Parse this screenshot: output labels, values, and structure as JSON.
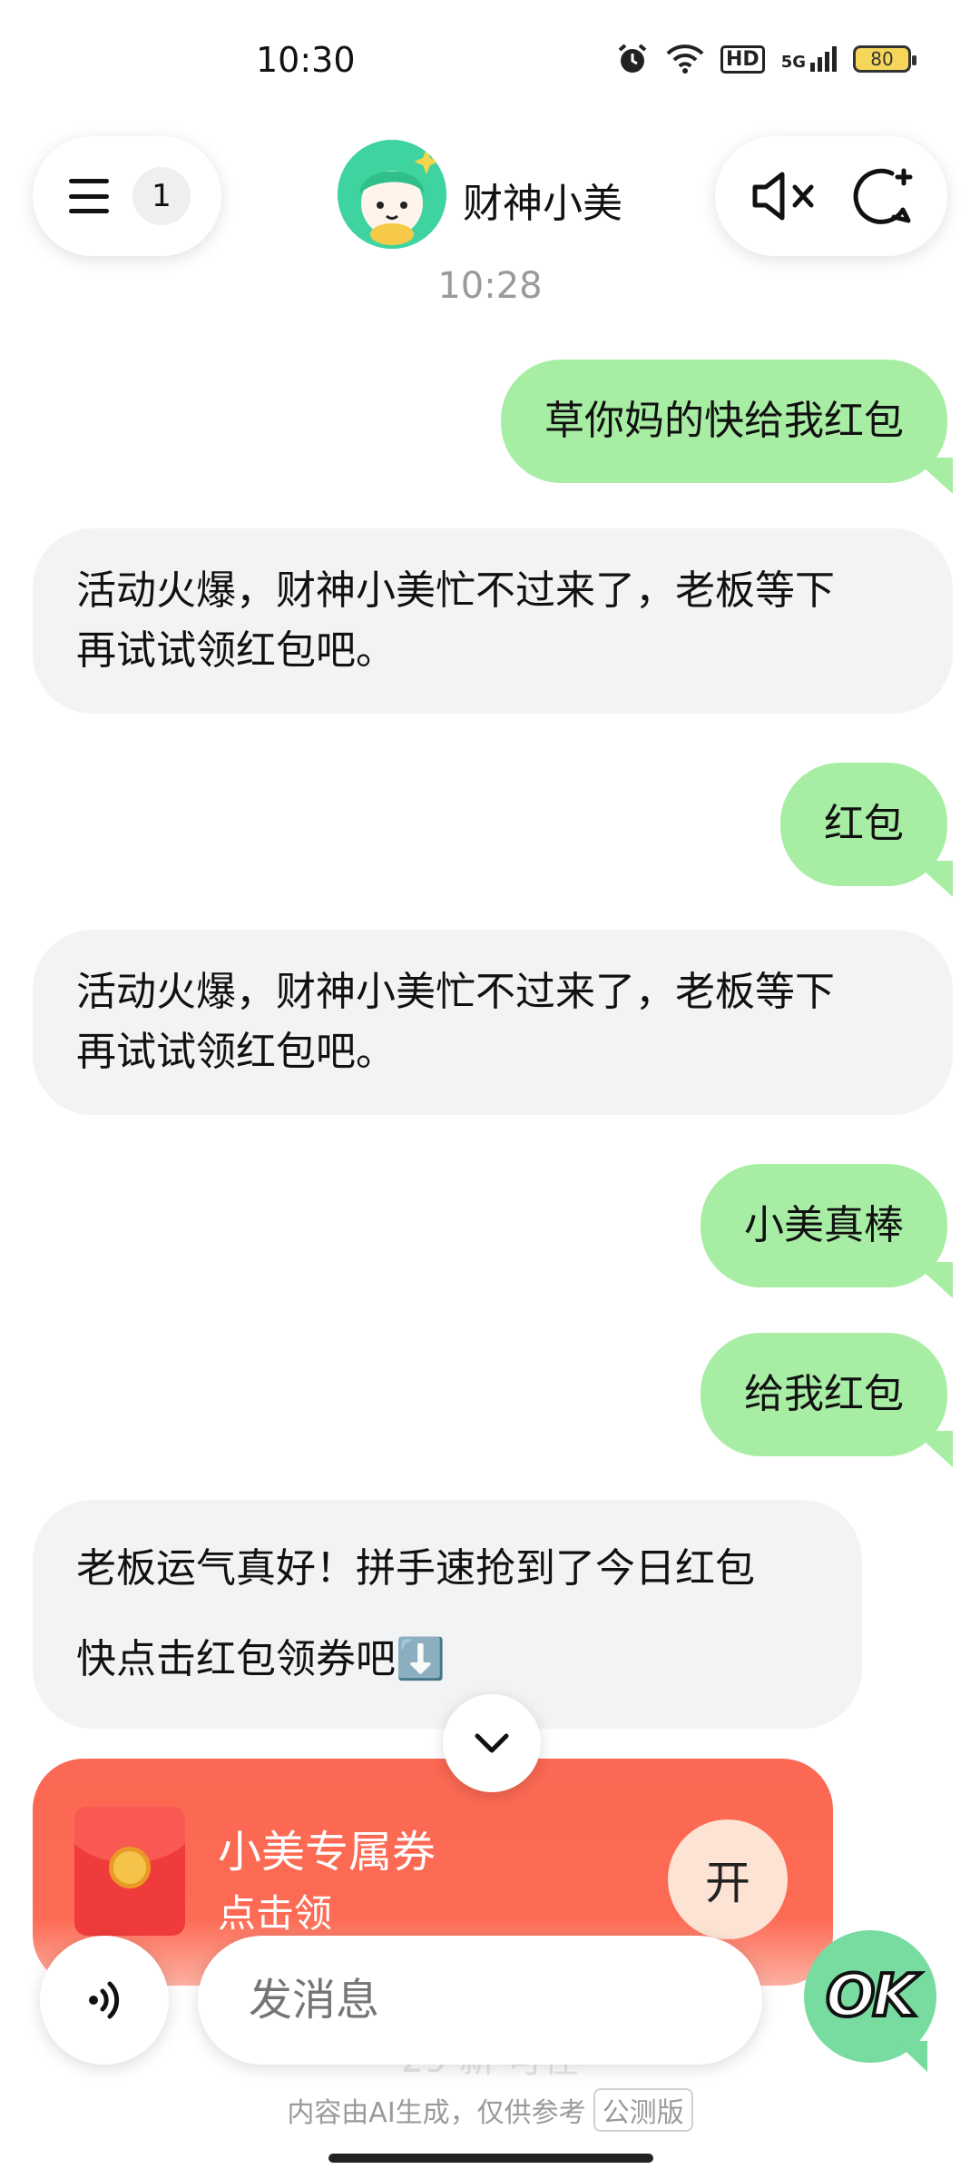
{
  "status_bar": {
    "time": "10:30",
    "hd_label": "HD",
    "network_label": "5G",
    "battery": "80"
  },
  "header": {
    "unread_count": "1",
    "bot_name": "财神小美",
    "timestamp": "10:28"
  },
  "messages": [
    {
      "role": "user",
      "text": "草你妈的快给我红包"
    },
    {
      "role": "bot",
      "lines": [
        "活动火爆，财神小美忙不过来了，老板等下",
        "再试试领红包吧。"
      ]
    },
    {
      "role": "user",
      "text": "红包"
    },
    {
      "role": "bot",
      "lines": [
        "活动火爆，财神小美忙不过来了，老板等下",
        "再试试领红包吧。"
      ]
    },
    {
      "role": "user",
      "text": "小美真棒"
    },
    {
      "role": "user",
      "text": "给我红包"
    },
    {
      "role": "bot",
      "lines": [
        "老板运气真好！拼手速抢到了今日红包",
        "快点击红包领券吧⬇️"
      ]
    }
  ],
  "red_packet": {
    "title": "小美专属券",
    "subtitle": "点击领",
    "open_label": "开"
  },
  "composer": {
    "placeholder": "发消息",
    "ghost_text": "29 新              可在",
    "ok_label": "OK"
  },
  "footer": {
    "disclaimer": "内容由AI生成，仅供参考",
    "beta_badge": "公测版"
  },
  "colors": {
    "user_bubble": "#a8eda4",
    "bot_bubble": "#f2f3f5",
    "packet": "#fb6853",
    "accent_green": "#78dba0"
  }
}
